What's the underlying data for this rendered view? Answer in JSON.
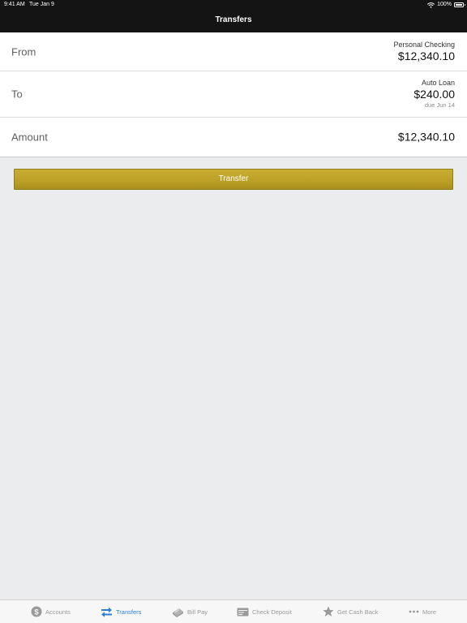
{
  "status_bar": {
    "time": "9:41 AM",
    "date": "Tue Jan 9",
    "battery": "100%"
  },
  "header": {
    "title": "Transfers"
  },
  "form": {
    "from": {
      "label": "From",
      "account_name": "Personal Checking",
      "amount": "$12,340.10"
    },
    "to": {
      "label": "To",
      "account_name": "Auto Loan",
      "amount": "$240.00",
      "due": "due Jun 14"
    },
    "amount": {
      "label": "Amount",
      "value": "$12,340.10"
    }
  },
  "transfer_button": {
    "label": "Transfer"
  },
  "tab_bar": {
    "tabs": [
      {
        "label": "Accounts",
        "icon": "dollar-circle-icon",
        "active": false
      },
      {
        "label": "Transfers",
        "icon": "transfer-arrows-icon",
        "active": true
      },
      {
        "label": "Bill Pay",
        "icon": "bill-pay-icon",
        "active": false
      },
      {
        "label": "Check Deposit",
        "icon": "check-icon",
        "active": false
      },
      {
        "label": "Get Cash Back",
        "icon": "star-icon",
        "active": false
      },
      {
        "label": "More",
        "icon": "more-dots-icon",
        "active": false
      }
    ]
  },
  "colors": {
    "header_bg": "#141414",
    "accent_blue": "#2b7fd6",
    "button_gold": "#bda127",
    "background": "#eaecee"
  }
}
